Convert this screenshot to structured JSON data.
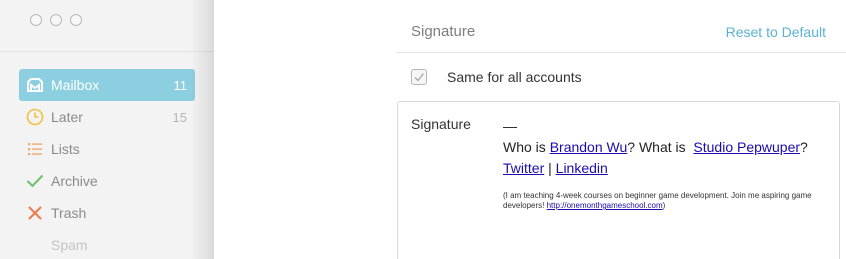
{
  "sidebar": {
    "items": [
      {
        "label": "Mailbox",
        "count": "11",
        "icon": "mailbox-icon",
        "color": "#8ccfe1"
      },
      {
        "label": "Later",
        "count": "15",
        "icon": "clock-icon",
        "color": "#f4c042"
      },
      {
        "label": "Lists",
        "count": "",
        "icon": "list-icon",
        "color": "#f0a868"
      },
      {
        "label": "Archive",
        "count": "",
        "icon": "checkmark-icon",
        "color": "#6cc16a"
      },
      {
        "label": "Trash",
        "count": "",
        "icon": "x-icon",
        "color": "#ef7a4a"
      },
      {
        "label": "Spam",
        "count": "",
        "icon": "",
        "color": ""
      }
    ]
  },
  "header": {
    "title": "Signature",
    "reset_label": "Reset to Default"
  },
  "same_for_all": {
    "label": "Same for all accounts",
    "checked": false
  },
  "signature": {
    "label": "Signature",
    "dash": "—",
    "line1_prefix": "Who is ",
    "line1_name": "Brandon Wu",
    "line1_mid": "? What is  ",
    "line1_studio": "Studio Pepwuper",
    "line1_suffix": "?",
    "twitter": "Twitter",
    "separator": " | ",
    "linkedin": "Linkedin",
    "small_text": "(I am teaching 4-week courses on beginner game development. Join me aspiring game developers! ",
    "small_link": "http://onemonthgameschool.com",
    "small_end": ")"
  }
}
